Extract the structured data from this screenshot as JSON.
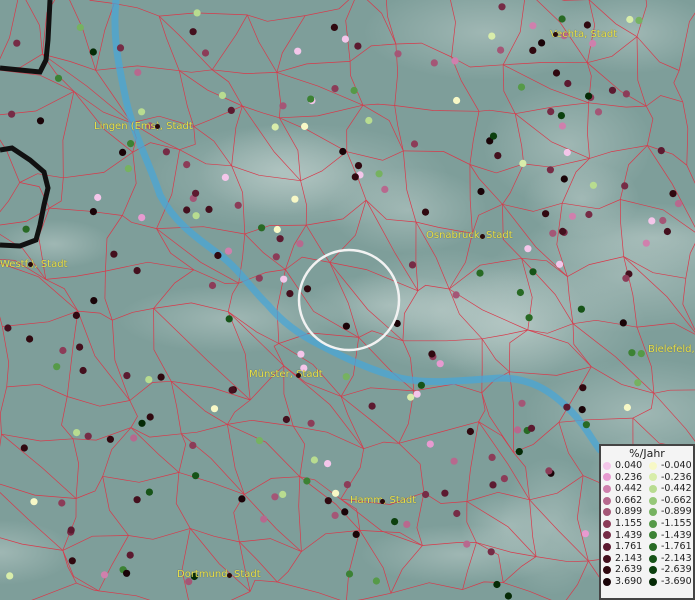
{
  "map": {
    "cities": [
      {
        "label": "Vechta, Stadt"
      },
      {
        "label": "Lingen (Ems), Stadt"
      },
      {
        "label": "Osnabrück, Stadt"
      },
      {
        "label": "Westf.), Stadt"
      },
      {
        "label": "Bielefeld,"
      },
      {
        "label": "Münster, Stadt"
      },
      {
        "label": "Hamm, Stadt"
      },
      {
        "label": "Dortmund, Stadt"
      }
    ],
    "selection_circle": true
  },
  "legend": {
    "title": "%/Jahr",
    "positive": {
      "values": [
        "0.040",
        "0.236",
        "0.442",
        "0.662",
        "0.899",
        "1.155",
        "1.439",
        "1.761",
        "2.143",
        "2.639",
        "3.690"
      ],
      "colors": [
        "#f4c6ea",
        "#e79ad0",
        "#cf80ad",
        "#b7698e",
        "#a45676",
        "#8c3c58",
        "#762c46",
        "#5c1a30",
        "#44101e",
        "#300910",
        "#1a0408"
      ]
    },
    "negative": {
      "values": [
        "-0.040",
        "-0.236",
        "-0.442",
        "-0.662",
        "-0.899",
        "-1.155",
        "-1.439",
        "-1.761",
        "-2.143",
        "-2.639",
        "-3.690"
      ],
      "colors": [
        "#f7f8c6",
        "#d8edaa",
        "#b8dc90",
        "#96c878",
        "#76b260",
        "#569a48",
        "#3c8234",
        "#286a24",
        "#175418",
        "#0c400e",
        "#052a06"
      ]
    }
  },
  "colors": {
    "background": "#7e9e9a",
    "boundary": "#d8394a",
    "river": "#49a6d6",
    "border": "#111111",
    "city_label": "#e8e24a"
  }
}
